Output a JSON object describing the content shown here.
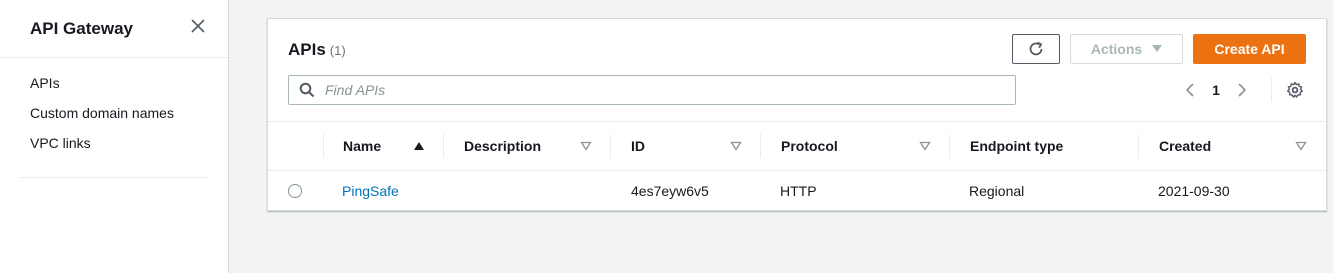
{
  "sidebar": {
    "title": "API Gateway",
    "items": [
      {
        "label": "APIs"
      },
      {
        "label": "Custom domain names"
      },
      {
        "label": "VPC links"
      }
    ]
  },
  "panel": {
    "title": "APIs",
    "count": "(1)",
    "actions_label": "Actions",
    "create_label": "Create API",
    "search_placeholder": "Find APIs",
    "current_page": "1"
  },
  "table": {
    "columns": [
      "Name",
      "Description",
      "ID",
      "Protocol",
      "Endpoint type",
      "Created"
    ],
    "rows": [
      {
        "name": "PingSafe",
        "description": "",
        "id": "4es7eyw6v5",
        "protocol": "HTTP",
        "endpoint_type": "Regional",
        "created": "2021-09-30"
      }
    ]
  },
  "colors": {
    "primary": "#ec7211",
    "link": "#0073bb"
  }
}
